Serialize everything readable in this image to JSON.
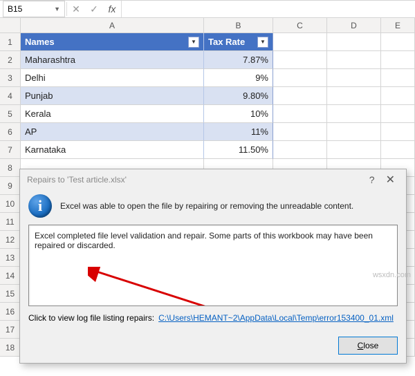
{
  "namebox": {
    "value": "B15"
  },
  "formula_bar": {
    "fx_label": "fx",
    "value": ""
  },
  "columns": [
    "A",
    "B",
    "C",
    "D",
    "E"
  ],
  "table": {
    "headers": {
      "a": "Names",
      "b": "Tax Rate"
    },
    "rows": [
      {
        "name": "Maharashtra",
        "rate": "7.87%"
      },
      {
        "name": "Delhi",
        "rate": "9%"
      },
      {
        "name": "Punjab",
        "rate": "9.80%"
      },
      {
        "name": "Kerala",
        "rate": "10%"
      },
      {
        "name": "AP",
        "rate": "11%"
      },
      {
        "name": "Karnataka",
        "rate": "11.50%"
      }
    ]
  },
  "row_numbers": [
    "1",
    "2",
    "3",
    "4",
    "5",
    "6",
    "7",
    "8",
    "9",
    "10",
    "11",
    "12",
    "13",
    "14",
    "15",
    "16",
    "17",
    "18"
  ],
  "dialog": {
    "title": "Repairs to 'Test article.xlsx'",
    "message": "Excel was able to open the file by repairing or removing the unreadable content.",
    "log_text": "Excel completed file level validation and repair. Some parts of this workbook may have been repaired or discarded.",
    "link_label": "Click to view log file listing repairs:",
    "link_path": "C:\\Users\\HEMANT~2\\AppData\\Local\\Temp\\error153400_01.xml",
    "close_label": "Close"
  },
  "watermark": "wsxdn.com"
}
